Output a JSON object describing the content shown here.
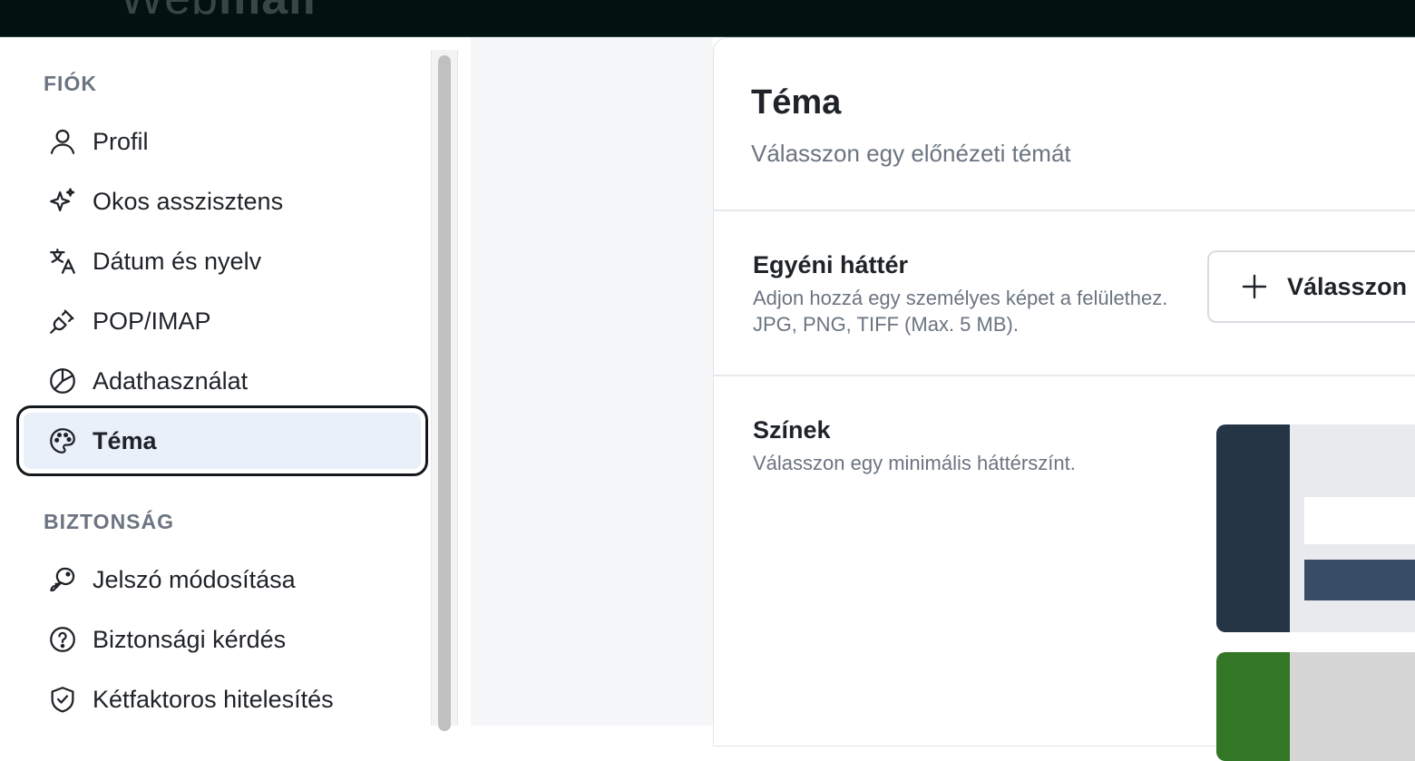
{
  "header": {
    "logo_light": "Web",
    "logo_bold": "mail"
  },
  "sidebar": {
    "sections": [
      {
        "title": "FIÓK",
        "items": [
          {
            "label": "Profil",
            "icon": "user-icon"
          },
          {
            "label": "Okos asszisztens",
            "icon": "sparkles-icon"
          },
          {
            "label": "Dátum és nyelv",
            "icon": "translate-icon"
          },
          {
            "label": "POP/IMAP",
            "icon": "plug-icon"
          },
          {
            "label": "Adathasználat",
            "icon": "pie-chart-icon"
          },
          {
            "label": "Téma",
            "icon": "palette-icon",
            "active": true
          }
        ]
      },
      {
        "title": "BIZTONSÁG",
        "items": [
          {
            "label": "Jelszó módosítása",
            "icon": "key-icon"
          },
          {
            "label": "Biztonsági kérdés",
            "icon": "question-circle-icon"
          },
          {
            "label": "Kétfaktoros hitelesítés",
            "icon": "shield-check-icon"
          }
        ]
      }
    ]
  },
  "main": {
    "title": "Téma",
    "subtitle": "Válasszon egy előnézeti témát",
    "custom_background": {
      "title": "Egyéni háttér",
      "description": "Adjon hozzá egy személyes képet a felülethez. JPG, PNG, TIFF (Max. 5 MB).",
      "button_label": "Válasszon"
    },
    "colors": {
      "title": "Színek",
      "description": "Válasszon egy minimális háttérszínt.",
      "swatches": [
        {
          "sidebar_color": "#263545",
          "main_color": "#e8eaee",
          "accent_color": "#384c66"
        },
        {
          "sidebar_color": "#327626",
          "main_color": "#d6d6d6",
          "accent_color": "#327626"
        }
      ]
    }
  }
}
